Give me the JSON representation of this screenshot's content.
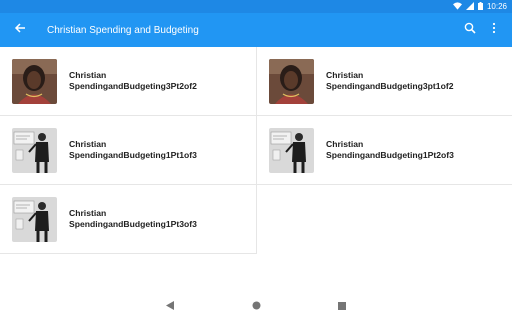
{
  "status_bar": {
    "time": "10:26",
    "icons": [
      "wifi-icon",
      "signal-icon",
      "battery-icon"
    ]
  },
  "app_bar": {
    "title": "Christian Spending and Budgeting",
    "background_color": "#2196f3",
    "status_color": "#1e88e5",
    "icons": [
      "back-arrow-icon",
      "search-icon",
      "more-vert-icon"
    ]
  },
  "items": [
    {
      "line1": "Christian",
      "line2": "SpendingandBudgeting3Pt2of2",
      "thumbnail": "woman-portrait"
    },
    {
      "line1": "Christian",
      "line2": "SpendingandBudgeting3pt1of2",
      "thumbnail": "woman-portrait"
    },
    {
      "line1": "Christian",
      "line2": "SpendingandBudgeting1Pt1of3",
      "thumbnail": "man-at-whiteboard"
    },
    {
      "line1": "Christian",
      "line2": "SpendingandBudgeting1Pt2of3",
      "thumbnail": "man-at-whiteboard"
    },
    {
      "line1": "Christian",
      "line2": "SpendingandBudgeting1Pt3of3",
      "thumbnail": "man-at-whiteboard"
    }
  ],
  "nav_bar": {
    "icons": [
      "back-triangle-icon",
      "home-circle-icon",
      "recents-square-icon"
    ]
  }
}
